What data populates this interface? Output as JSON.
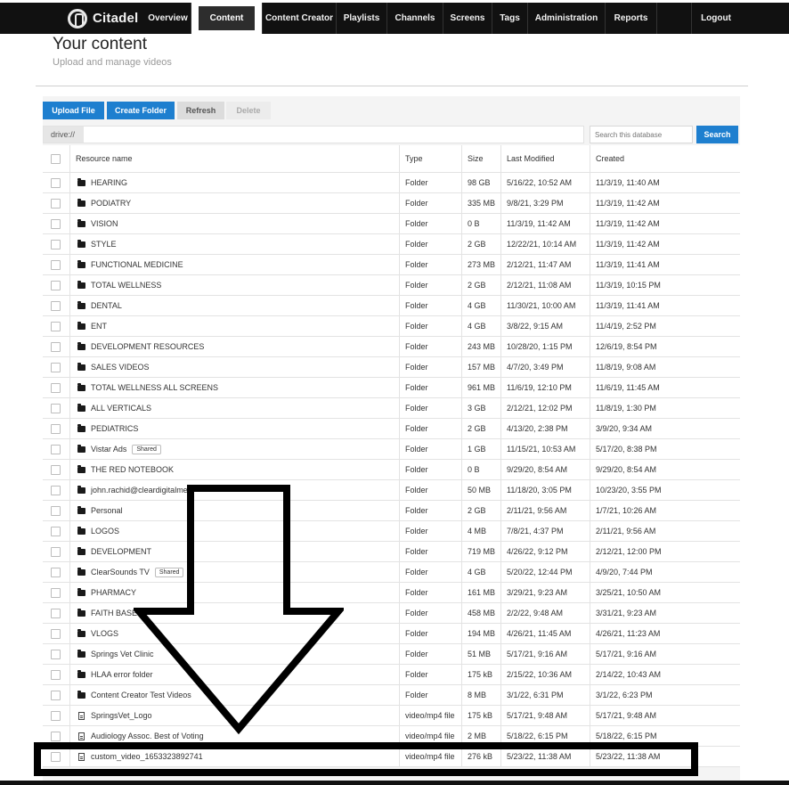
{
  "nav": {
    "brand": "Citadel",
    "items": [
      {
        "label": "Overview",
        "active": false
      },
      {
        "label": "Content",
        "active": true
      },
      {
        "label": "Content Creator",
        "active": false
      },
      {
        "label": "Playlists",
        "active": false
      },
      {
        "label": "Channels",
        "active": false
      },
      {
        "label": "Screens",
        "active": false
      },
      {
        "label": "Tags",
        "active": false
      },
      {
        "label": "Administration",
        "active": false
      },
      {
        "label": "Reports",
        "active": false
      }
    ],
    "logout": "Logout"
  },
  "header": {
    "title": "Your content",
    "subtitle": "Upload and manage videos"
  },
  "toolbar": {
    "upload": "Upload File",
    "create_folder": "Create Folder",
    "refresh": "Refresh",
    "delete": "Delete"
  },
  "path": {
    "prefix": "drive://"
  },
  "search": {
    "placeholder": "Search this database",
    "button": "Search"
  },
  "table": {
    "columns": [
      "Resource name",
      "Type",
      "Size",
      "Last Modified",
      "Created"
    ],
    "rows": [
      {
        "name": "HEARING",
        "icon": "folder-icon",
        "type": "Folder",
        "size": "98 GB",
        "modified": "5/16/22, 10:52 AM",
        "created": "11/3/19, 11:40 AM"
      },
      {
        "name": "PODIATRY",
        "icon": "folder-icon",
        "type": "Folder",
        "size": "335 MB",
        "modified": "9/8/21, 3:29 PM",
        "created": "11/3/19, 11:42 AM"
      },
      {
        "name": "VISION",
        "icon": "folder-icon",
        "type": "Folder",
        "size": "0 B",
        "modified": "11/3/19, 11:42 AM",
        "created": "11/3/19, 11:42 AM"
      },
      {
        "name": "STYLE",
        "icon": "folder-icon",
        "type": "Folder",
        "size": "2 GB",
        "modified": "12/22/21, 10:14 AM",
        "created": "11/3/19, 11:42 AM"
      },
      {
        "name": "FUNCTIONAL MEDICINE",
        "icon": "folder-icon",
        "type": "Folder",
        "size": "273 MB",
        "modified": "2/12/21, 11:47 AM",
        "created": "11/3/19, 11:41 AM"
      },
      {
        "name": "TOTAL WELLNESS",
        "icon": "folder-icon",
        "type": "Folder",
        "size": "2 GB",
        "modified": "2/12/21, 11:08 AM",
        "created": "11/3/19, 10:15 PM"
      },
      {
        "name": "DENTAL",
        "icon": "folder-icon",
        "type": "Folder",
        "size": "4 GB",
        "modified": "11/30/21, 10:00 AM",
        "created": "11/3/19, 11:41 AM"
      },
      {
        "name": "ENT",
        "icon": "folder-icon",
        "type": "Folder",
        "size": "4 GB",
        "modified": "3/8/22, 9:15 AM",
        "created": "11/4/19, 2:52 PM"
      },
      {
        "name": "DEVELOPMENT RESOURCES",
        "icon": "folder-icon",
        "type": "Folder",
        "size": "243 MB",
        "modified": "10/28/20, 1:15 PM",
        "created": "12/6/19, 8:54 PM"
      },
      {
        "name": "SALES VIDEOS",
        "icon": "folder-icon",
        "type": "Folder",
        "size": "157 MB",
        "modified": "4/7/20, 3:49 PM",
        "created": "11/8/19, 9:08 AM"
      },
      {
        "name": "TOTAL WELLNESS ALL SCREENS",
        "icon": "folder-icon",
        "type": "Folder",
        "size": "961 MB",
        "modified": "11/6/19, 12:10 PM",
        "created": "11/6/19, 11:45 AM"
      },
      {
        "name": "ALL VERTICALS",
        "icon": "folder-icon",
        "type": "Folder",
        "size": "3 GB",
        "modified": "2/12/21, 12:02 PM",
        "created": "11/8/19, 1:30 PM"
      },
      {
        "name": "PEDIATRICS",
        "icon": "folder-icon",
        "type": "Folder",
        "size": "2 GB",
        "modified": "4/13/20, 2:38 PM",
        "created": "3/9/20, 9:34 AM"
      },
      {
        "name": "Vistar Ads",
        "icon": "folder-icon",
        "badge": "Shared",
        "type": "Folder",
        "size": "1 GB",
        "modified": "11/15/21, 10:53 AM",
        "created": "5/17/20, 8:38 PM"
      },
      {
        "name": "THE RED NOTEBOOK",
        "icon": "folder-icon",
        "type": "Folder",
        "size": "0 B",
        "modified": "9/29/20, 8:54 AM",
        "created": "9/29/20, 8:54 AM"
      },
      {
        "name": "john.rachid@cleardigitalme",
        "icon": "folder-icon",
        "type": "Folder",
        "size": "50 MB",
        "modified": "11/18/20, 3:05 PM",
        "created": "10/23/20, 3:55 PM"
      },
      {
        "name": "Personal",
        "icon": "folder-icon",
        "type": "Folder",
        "size": "2 GB",
        "modified": "2/11/21, 9:56 AM",
        "created": "1/7/21, 10:26 AM"
      },
      {
        "name": "LOGOS",
        "icon": "folder-icon",
        "type": "Folder",
        "size": "4 MB",
        "modified": "7/8/21, 4:37 PM",
        "created": "2/11/21, 9:56 AM"
      },
      {
        "name": "DEVELOPMENT",
        "icon": "folder-icon",
        "type": "Folder",
        "size": "719 MB",
        "modified": "4/26/22, 9:12 PM",
        "created": "2/12/21, 12:00 PM"
      },
      {
        "name": "ClearSounds TV",
        "icon": "folder-icon",
        "badge": "Shared",
        "type": "Folder",
        "size": "4 GB",
        "modified": "5/20/22, 12:44 PM",
        "created": "4/9/20, 7:44 PM"
      },
      {
        "name": "PHARMACY",
        "icon": "folder-icon",
        "type": "Folder",
        "size": "161 MB",
        "modified": "3/29/21, 9:23 AM",
        "created": "3/25/21, 10:50 AM"
      },
      {
        "name": "FAITH BASED",
        "icon": "folder-icon",
        "type": "Folder",
        "size": "458 MB",
        "modified": "2/2/22, 9:48 AM",
        "created": "3/31/21, 9:23 AM"
      },
      {
        "name": "VLOGS",
        "icon": "folder-icon",
        "type": "Folder",
        "size": "194 MB",
        "modified": "4/26/21, 11:45 AM",
        "created": "4/26/21, 11:23 AM"
      },
      {
        "name": "Springs Vet Clinic",
        "icon": "folder-icon",
        "type": "Folder",
        "size": "51 MB",
        "modified": "5/17/21, 9:16 AM",
        "created": "5/17/21, 9:16 AM"
      },
      {
        "name": "HLAA error folder",
        "icon": "folder-icon",
        "type": "Folder",
        "size": "175 kB",
        "modified": "2/15/22, 10:36 AM",
        "created": "2/14/22, 10:43 AM"
      },
      {
        "name": "Content Creator Test Videos",
        "icon": "folder-icon",
        "type": "Folder",
        "size": "8 MB",
        "modified": "3/1/22, 6:31 PM",
        "created": "3/1/22, 6:23 PM"
      },
      {
        "name": "SpringsVet_Logo",
        "icon": "file-icon",
        "type": "video/mp4 file",
        "size": "175 kB",
        "modified": "5/17/21, 9:48 AM",
        "created": "5/17/21, 9:48 AM"
      },
      {
        "name": "Audiology Assoc. Best of Voting",
        "icon": "file-icon",
        "type": "video/mp4 file",
        "size": "2 MB",
        "modified": "5/18/22, 6:15 PM",
        "created": "5/18/22, 6:15 PM"
      },
      {
        "name": "custom_video_1653323892741",
        "icon": "file-icon",
        "type": "video/mp4 file",
        "size": "276 kB",
        "modified": "5/23/22, 11:38 AM",
        "created": "5/23/22, 11:38 AM"
      }
    ]
  },
  "colors": {
    "nav_bg": "#111111",
    "accent_blue": "#1e7fcf",
    "panel_bg": "#f4f4f4"
  }
}
